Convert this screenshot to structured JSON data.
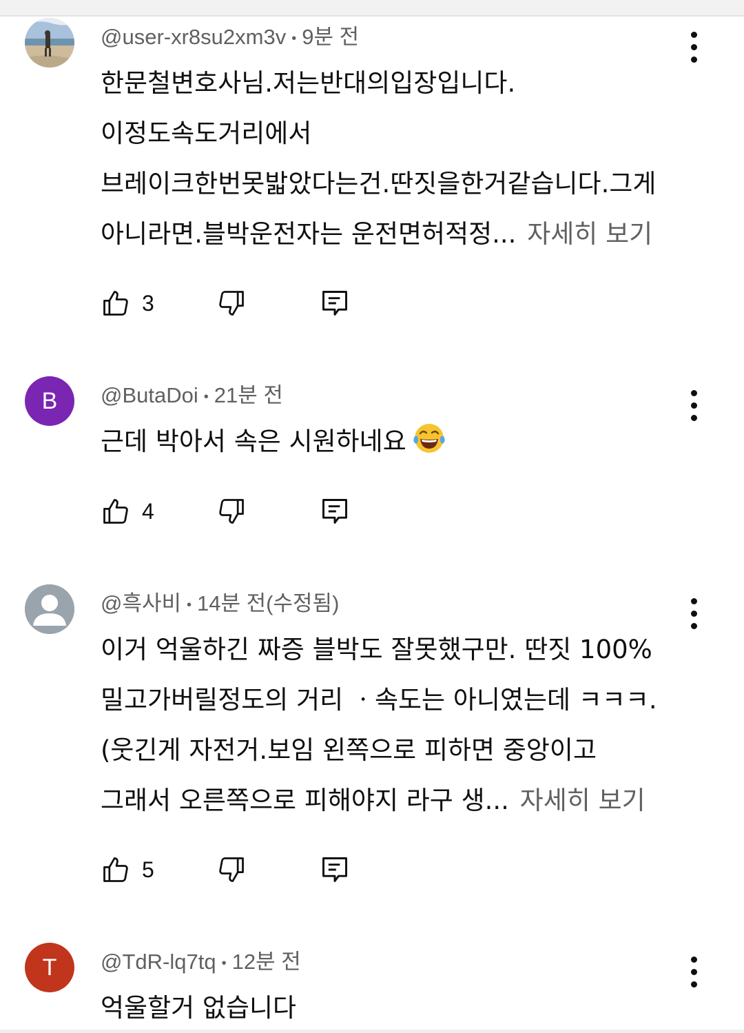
{
  "comments": [
    {
      "author": "@user-xr8su2xm3v",
      "time": "9분 전",
      "lines": [
        "한문철변호사님.저는반대의입장입니다.",
        "이정도속도거리에서",
        "브레이크한번못밟았다는건.딴짓을한거같습니다.그게",
        "아니라면.블박운전자는 운전면허적정..."
      ],
      "read_more": "자세히 보기",
      "likes": "3",
      "avatar_type": "photo"
    },
    {
      "author": "@ButaDoi",
      "time": "21분 전",
      "lines": [
        "근데 박아서 속은 시원하네요"
      ],
      "emoji": "face-with-tears-of-joy",
      "likes": "4",
      "avatar_letter": "B",
      "avatar_color": "#7b25b3"
    },
    {
      "author": "@흑사비",
      "time": "14분 전(수정됨)",
      "lines": [
        "이거 억울하긴 짜증 블박도 잘못했구만. 딴짓 100%",
        "밀고가버릴정도의 거리 ㆍ속도는 아니였는데 ㅋㅋㅋ.",
        "(웃긴게 자전거.보임 왼쪽으로 피하면 중앙이고",
        "그래서 오른쪽으로 피해야지 라구 생..."
      ],
      "read_more": "자세히 보기",
      "likes": "5",
      "avatar_type": "default-user",
      "avatar_color": "#9aa4ad"
    },
    {
      "author": "@TdR-lq7tq",
      "time": "12분 전",
      "lines": [
        "억울할거 없습니다"
      ],
      "avatar_letter": "T",
      "avatar_color": "#c0351c"
    }
  ],
  "icons": {
    "like": "thumbs-up-icon",
    "dislike": "thumbs-down-icon",
    "reply": "reply-icon",
    "more": "more-vertical-icon"
  },
  "colors": {
    "text": "#0f0f0f",
    "secondary": "#606060"
  }
}
